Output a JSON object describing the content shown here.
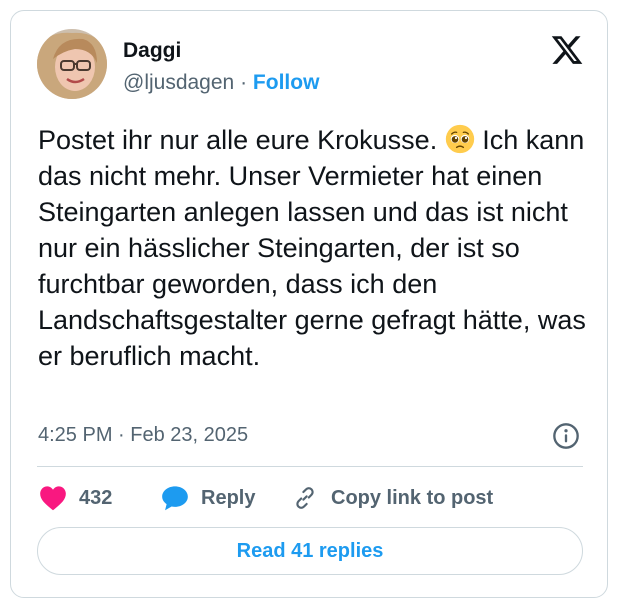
{
  "author": {
    "name": "Daggi",
    "handle": "@ljusdagen",
    "separator": "·",
    "follow_label": "Follow"
  },
  "tweet": {
    "text_before_emoji": "Postet ihr nur alle eure Krokusse. ",
    "emoji": "pleading-face-emoji",
    "text_after_emoji": " Ich kann das nicht mehr. Unser Vermieter hat einen Steingarten anlegen lassen und das ist nicht nur ein hässlicher Steingarten, der ist so furchtbar geworden, dass ich den Landschaftsgestalter gerne gefragt hätte, was er beruflich macht.",
    "timestamp": "4:25 PM · Feb 23, 2025"
  },
  "actions": {
    "like_count": "432",
    "reply_label": "Reply",
    "copy_label": "Copy link to post"
  },
  "read_replies_label": "Read 41 replies",
  "colors": {
    "accent": "#1d9bf0",
    "like": "#f91880",
    "muted": "#536471",
    "border": "#cfd9de"
  },
  "icons": [
    "x-logo-icon",
    "info-icon",
    "heart-icon",
    "reply-bubble-icon",
    "link-icon"
  ]
}
